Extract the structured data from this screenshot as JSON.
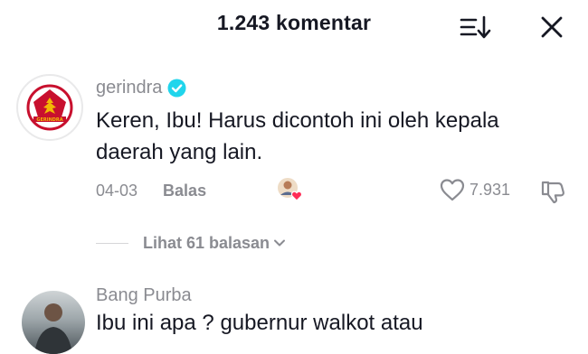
{
  "header": {
    "title": "1.243 komentar"
  },
  "comments": [
    {
      "author": "gerindra",
      "verified": true,
      "avatar_logo_text": "GERINDRA",
      "text": "Keren, Ibu! Harus dicontoh ini oleh kepala daerah yang lain.",
      "date": "04-03",
      "reply_label": "Balas",
      "likes": "7.931",
      "view_replies": "Lihat 61 balasan"
    },
    {
      "author": "Bang Purba",
      "text": "Ibu ini apa ? gubernur walkot atau"
    }
  ],
  "colors": {
    "primary_text": "#161823",
    "secondary_text": "#8a8b91",
    "verified_blue": "#20d5ec",
    "heart_red": "#fe2c55",
    "logo_red": "#c8102e",
    "logo_gold": "#f2b705"
  },
  "icons": {
    "sort": "sort-icon",
    "close": "close-icon",
    "verified": "verified-badge-icon",
    "like": "heart-outline-icon",
    "dislike": "dislike-icon",
    "creator_liked": "creator-liked-icon",
    "chevron": "chevron-down-icon"
  }
}
